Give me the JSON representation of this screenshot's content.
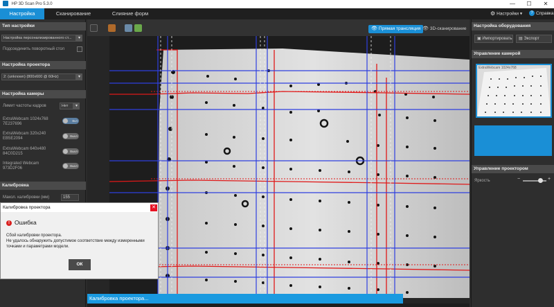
{
  "window": {
    "title": "HP 3D Scan Pro 5.3.0",
    "minimize": "—",
    "maximize": "☐",
    "close": "✕"
  },
  "menu": {
    "tabs": [
      {
        "label": "Настройка"
      },
      {
        "label": "Сканирование"
      },
      {
        "label": "Слияние форм"
      }
    ],
    "settings_label": "Настройки ▾",
    "help_label": "Справка",
    "help_glyph": "?"
  },
  "left": {
    "setup_type": {
      "header": "Тип настройки",
      "combo_value": "Настройка персонализированного ст...",
      "turntable_label": "Подсоединить поворотный стол"
    },
    "projector_setup": {
      "header": "Настройка проектора",
      "combo_value": "2: (unknown) (800x600 @ 60Hz)"
    },
    "camera_setup": {
      "header": "Настройка камеры",
      "fps_label": "Лимит частоты кадров",
      "fps_value": "Нет",
      "cameras": [
        {
          "name": "ExtraWebcam 1024x768",
          "id": "7E237696",
          "state": "Вкл"
        },
        {
          "name": "ExtraWebcam 320x240",
          "id": "EB5E2094",
          "state": "Выкл"
        },
        {
          "name": "ExtraWebcam 640x480",
          "id": "84C0D215",
          "state": "Выкл"
        },
        {
          "name": "Integrated Webcam",
          "id": "973D2F06",
          "state": "Выкл"
        }
      ]
    },
    "calibration": {
      "header": "Калибровка",
      "size_label": "Макол. калибровки (мм)",
      "size_value": "155"
    }
  },
  "toolbar": {
    "live_label": "Прямая трансляция",
    "scan3d_label": "3D-сканирование",
    "eye_glyph": "👁"
  },
  "status": {
    "text": "Калибровка проектора..."
  },
  "right": {
    "hardware": {
      "header": "Настройка оборудования",
      "import_label": "Импортировать",
      "export_label": "Экспорт"
    },
    "camera_control": {
      "header": "Управление камерой",
      "preview_label": "ExtraWebcam 1024x768"
    },
    "projector_control": {
      "header": "Управление проектором",
      "brightness_label": "Яркость",
      "minus": "−",
      "plus": "+",
      "brightness_level": 0.75
    }
  },
  "dialog": {
    "title": "Калибровка проектора",
    "close_glyph": "✕",
    "error_glyph": "!",
    "error_title": "Ошибка",
    "message_line1": "Сбой калибровки проектора.",
    "message_line2": "Не удалось обнаружить допустимое соответствие между измеренными точками и параметрами модели.",
    "ok_label": "ОК"
  },
  "colors": {
    "accent": "#1a8fd6",
    "status_bar": "#1a9ae0",
    "error": "#d9201f",
    "grid_blue": "#2e3fe0",
    "grid_red": "#e01818"
  }
}
